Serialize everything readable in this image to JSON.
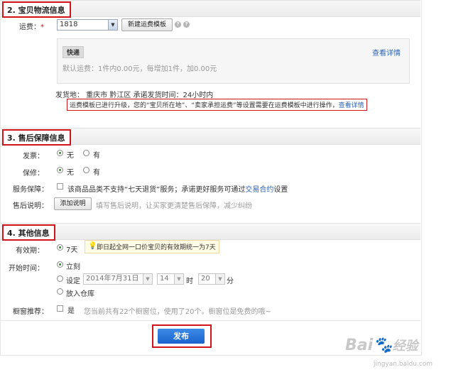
{
  "logistics": {
    "title": "2. 宝贝物流信息",
    "freight_label": "运费：",
    "required_mark": "*",
    "freight_value": "1818",
    "new_template_btn": "新建运费模板",
    "express_tag": "快递",
    "view_details": "查看详情",
    "default_freight": "默认运费：1件内0.00元，每增加1件，加0.00元",
    "ship_from": "发货地：  重庆市 黔江区  承诺发货时间：24小时内",
    "notice_text": "运费模板已进行升级，您的“宝贝所在地”、“卖家承担运费”等设置需要在运费模板中进行操作，",
    "notice_link": "查看详情"
  },
  "aftersale": {
    "title": "3. 售后保障信息",
    "invoice_label": "发票：",
    "warranty_label": "保修：",
    "opt_no": "无",
    "opt_yes": "有",
    "service_label": "服务保障：",
    "service_text": "该商品品类不支持“七天退货”服务；承诺更好服务可通过",
    "service_link": "交易合约",
    "service_suffix": "设置",
    "desc_label": "售后说明：",
    "add_desc_btn": "添加说明",
    "desc_hint": "填写售后说明，让买家更清楚售后保障，减少纠纷"
  },
  "other": {
    "title": "4. 其他信息",
    "validity_label": "有效期：",
    "validity_value": "7天",
    "validity_tip": "即日起全网一口价宝贝的有效期统一为7天",
    "start_label": "开始时间：",
    "start_now": "立刻",
    "start_set": "设定",
    "date_value": "2014年7月31日",
    "hour_value": "14",
    "hour_unit": "时",
    "minute_value": "20",
    "minute_unit": "分",
    "start_warehouse": "放入仓库",
    "window_label": "橱窗推荐：",
    "window_yes": "是",
    "window_hint": "您当前共有22个橱窗位，使用了20个。橱窗位是免费的哦~"
  },
  "publish_btn": "发布",
  "watermark": {
    "brand": "Bai",
    "brand_suffix": "经验",
    "url": "jingyan.baidu.com"
  },
  "colors": {
    "highlight_red": "#d0141a",
    "link_blue": "#2d64b3",
    "publish_blue": "#1863cc"
  }
}
